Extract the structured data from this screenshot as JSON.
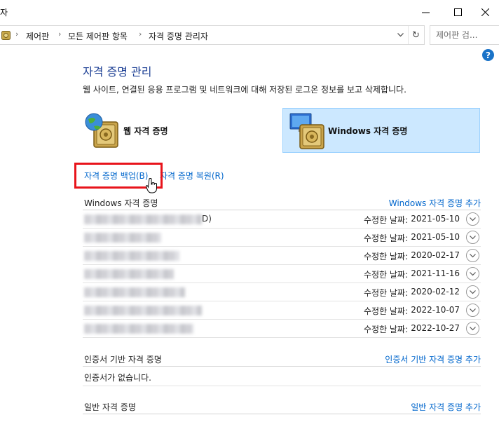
{
  "window": {
    "title": "자",
    "min_label": "─",
    "max_label": "☐",
    "close_label": "✕"
  },
  "address": {
    "crumbs": [
      "제어판",
      "모든 제어판 항목",
      "자격 증명 관리자"
    ],
    "search_placeholder": "제어판 검..."
  },
  "header": {
    "title": "자격 증명 관리",
    "description": "웹 사이트, 연결된 응용 프로그램 및 네트워크에 대해 저장된 로그온 정보를 보고 삭제합니다."
  },
  "tiles": {
    "web": "웹 자격 증명",
    "windows": "Windows 자격 증명",
    "selected": "windows"
  },
  "actions": {
    "backup": "자격 증명 백업(B)",
    "restore": "자격 증명 복원(R)"
  },
  "windows_section": {
    "title": "Windows 자격 증명",
    "add_label": "Windows 자격 증명 추가",
    "date_label": "수정한 날짜:",
    "first_suffix": "D)",
    "rows": [
      {
        "date": "2021-05-10"
      },
      {
        "date": "2021-05-10"
      },
      {
        "date": "2020-02-17"
      },
      {
        "date": "2021-11-16"
      },
      {
        "date": "2020-02-12"
      },
      {
        "date": "2022-10-07"
      },
      {
        "date": "2022-10-27"
      }
    ]
  },
  "cert_section": {
    "title": "인증서 기반 자격 증명",
    "add_label": "인증서 기반 자격 증명 추가",
    "empty_text": "인증서가 없습니다."
  },
  "generic_section": {
    "title": "일반 자격 증명",
    "add_label": "일반 자격 증명 추가"
  },
  "colors": {
    "link": "#0066cc",
    "title": "#1c3f94",
    "selected_tile": "#cce8ff",
    "highlight_box": "#e8141b"
  }
}
